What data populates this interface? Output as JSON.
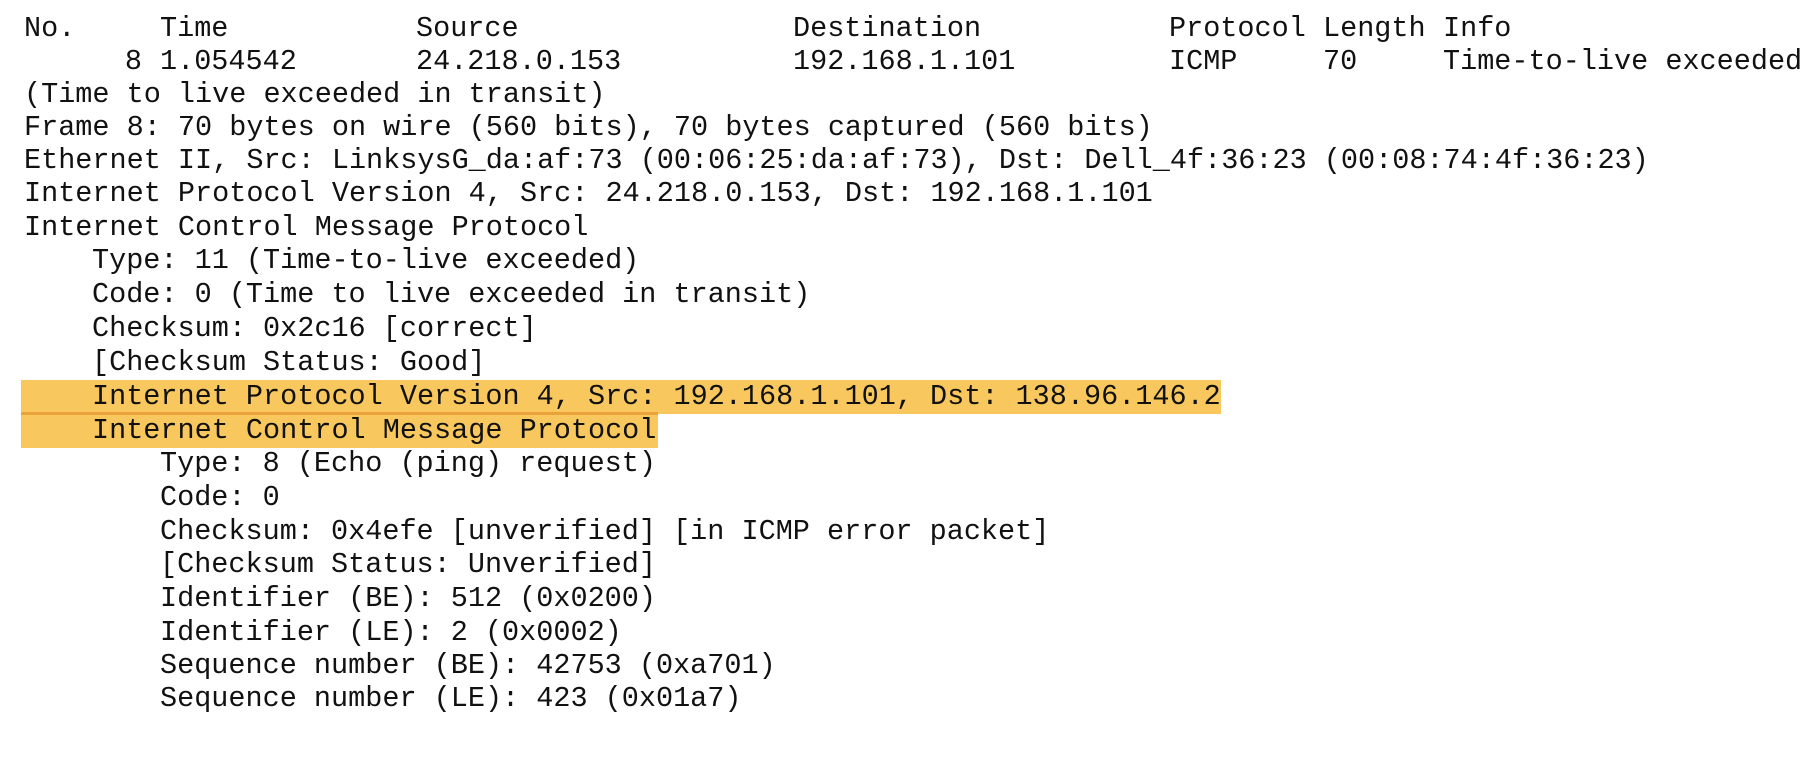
{
  "packet_list": {
    "columns": [
      "No.",
      "Time",
      "Source",
      "Destination",
      "Protocol",
      "Length",
      "Info"
    ],
    "row": {
      "no": "8",
      "time": "1.054542",
      "source": "24.218.0.153",
      "destination": "192.168.1.101",
      "protocol": "ICMP",
      "length": "70",
      "info": "Time-to-live exceeded"
    }
  },
  "details": [
    "(Time to live exceeded in transit)",
    "Frame 8: 70 bytes on wire (560 bits), 70 bytes captured (560 bits)",
    "Ethernet II, Src: LinksysG_da:af:73 (00:06:25:da:af:73), Dst: Dell_4f:36:23 (00:08:74:4f:36:23)",
    "Internet Protocol Version 4, Src: 24.218.0.153, Dst: 192.168.1.101",
    "Internet Control Message Protocol",
    "Type: 11 (Time-to-live exceeded)",
    "Code: 0 (Time to live exceeded in transit)",
    "Checksum: 0x2c16 [correct]",
    "[Checksum Status: Good]",
    "Internet Protocol Version 4, Src: 192.168.1.101, Dst: 138.96.146.2",
    "Internet Control Message Protocol",
    "Type: 8 (Echo (ping) request)",
    "Code: 0",
    "Checksum: 0x4efe [unverified] [in ICMP error packet]",
    "[Checksum Status: Unverified]",
    "Identifier (BE): 512 (0x0200)",
    "Identifier (LE): 2 (0x0002)",
    "Sequence number (BE): 42753 (0xa701)",
    "Sequence number (LE): 423 (0x01a7)"
  ],
  "colors": {
    "highlight": "#f8c85e",
    "highlight_divider": "#e9a33a",
    "text": "#111111",
    "background": "#ffffff"
  }
}
